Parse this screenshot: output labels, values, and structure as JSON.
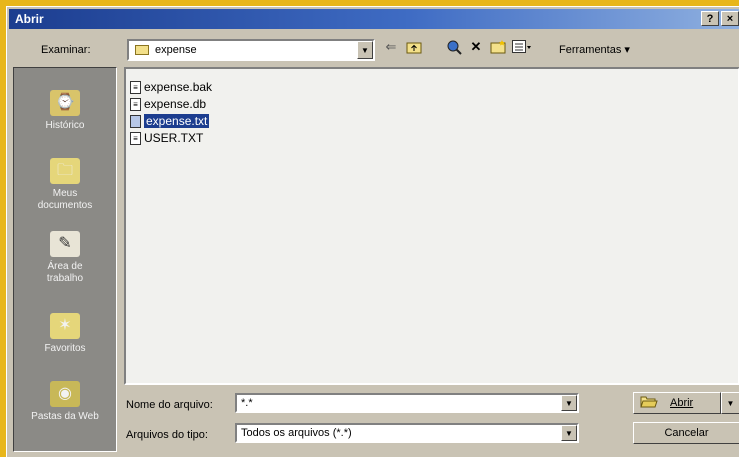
{
  "window": {
    "title": "Abrir",
    "help_label": "?",
    "close_label": "×"
  },
  "toolbar": {
    "lookin_label": "Examinar:",
    "lookin_value": "expense",
    "tools_label": "Ferramentas"
  },
  "places": [
    {
      "label": "Histórico",
      "icon": "history-icon"
    },
    {
      "label": "Meus documentos",
      "icon": "my-documents-icon"
    },
    {
      "label": "Área de trabalho",
      "icon": "desktop-icon"
    },
    {
      "label": "Favoritos",
      "icon": "favorites-icon"
    },
    {
      "label": "Pastas da Web",
      "icon": "web-folders-icon"
    }
  ],
  "files": [
    {
      "name": "expense.bak",
      "selected": false
    },
    {
      "name": "expense.db",
      "selected": false
    },
    {
      "name": "expense.txt",
      "selected": true
    },
    {
      "name": "USER.TXT",
      "selected": false
    }
  ],
  "bottom": {
    "filename_label": "Nome do arquivo:",
    "filename_value": "*.*",
    "filetype_label": "Arquivos do tipo:",
    "filetype_value": "Todos os arquivos (*.*)",
    "open_label": "Abrir",
    "cancel_label": "Cancelar"
  }
}
